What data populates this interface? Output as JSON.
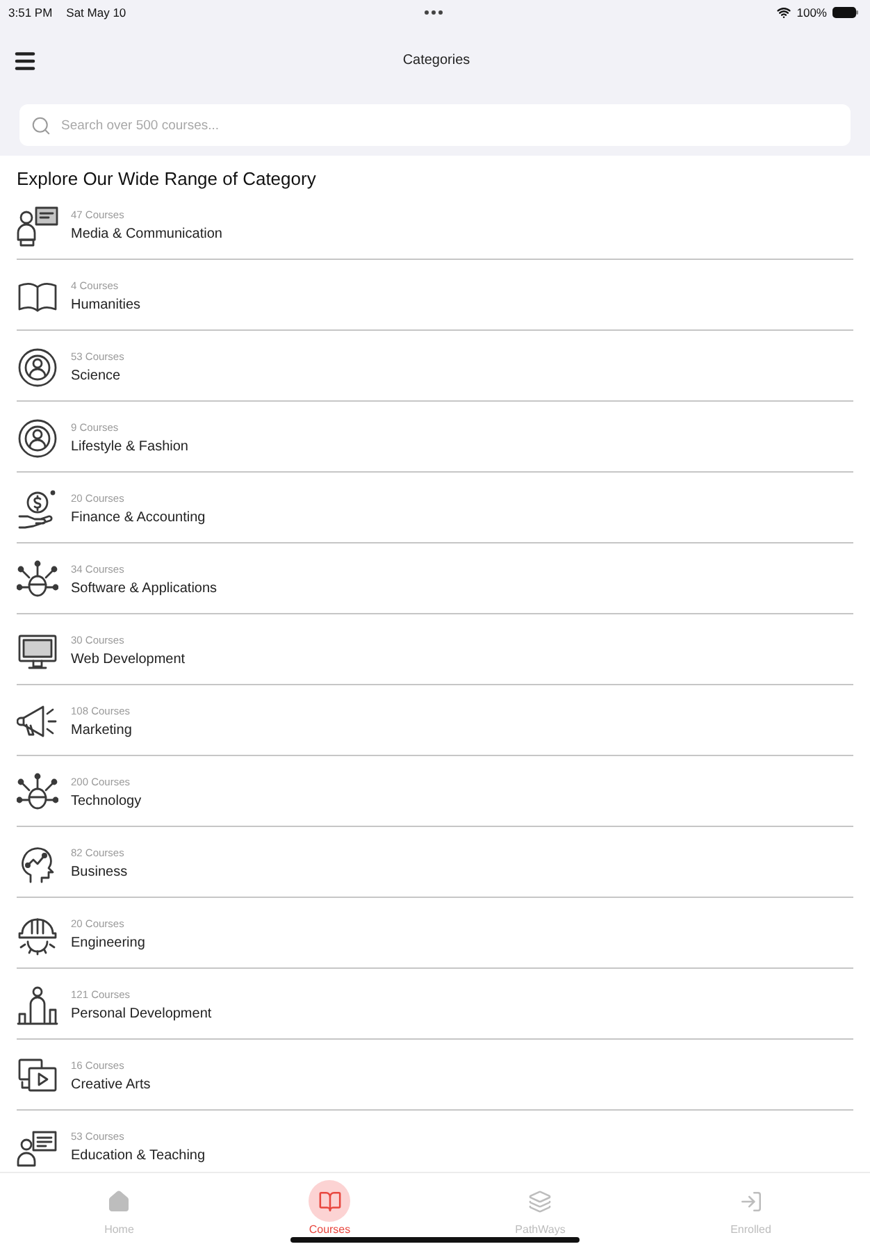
{
  "status_bar": {
    "time": "3:51 PM",
    "date": "Sat May 10",
    "battery": "100%"
  },
  "nav_bar": {
    "title": "Categories"
  },
  "search": {
    "placeholder": "Search over 500 courses..."
  },
  "section_title": "Explore Our Wide Range of Category",
  "categories": [
    {
      "count": "47 Courses",
      "name": "Media & Communication"
    },
    {
      "count": "4 Courses",
      "name": "Humanities"
    },
    {
      "count": "53 Courses",
      "name": "Science"
    },
    {
      "count": "9 Courses",
      "name": "Lifestyle & Fashion"
    },
    {
      "count": "20 Courses",
      "name": "Finance & Accounting"
    },
    {
      "count": "34 Courses",
      "name": "Software & Applications"
    },
    {
      "count": "30 Courses",
      "name": "Web Development"
    },
    {
      "count": "108 Courses",
      "name": "Marketing"
    },
    {
      "count": "200 Courses",
      "name": "Technology"
    },
    {
      "count": "82 Courses",
      "name": "Business"
    },
    {
      "count": "20 Courses",
      "name": "Engineering"
    },
    {
      "count": "121 Courses",
      "name": "Personal Development"
    },
    {
      "count": "16 Courses",
      "name": "Creative Arts"
    },
    {
      "count": "53 Courses",
      "name": "Education & Teaching"
    }
  ],
  "tab_bar": [
    {
      "label": "Home",
      "selected": false
    },
    {
      "label": "Courses",
      "selected": true
    },
    {
      "label": "PathWays",
      "selected": false
    },
    {
      "label": "Enrolled",
      "selected": false
    }
  ]
}
